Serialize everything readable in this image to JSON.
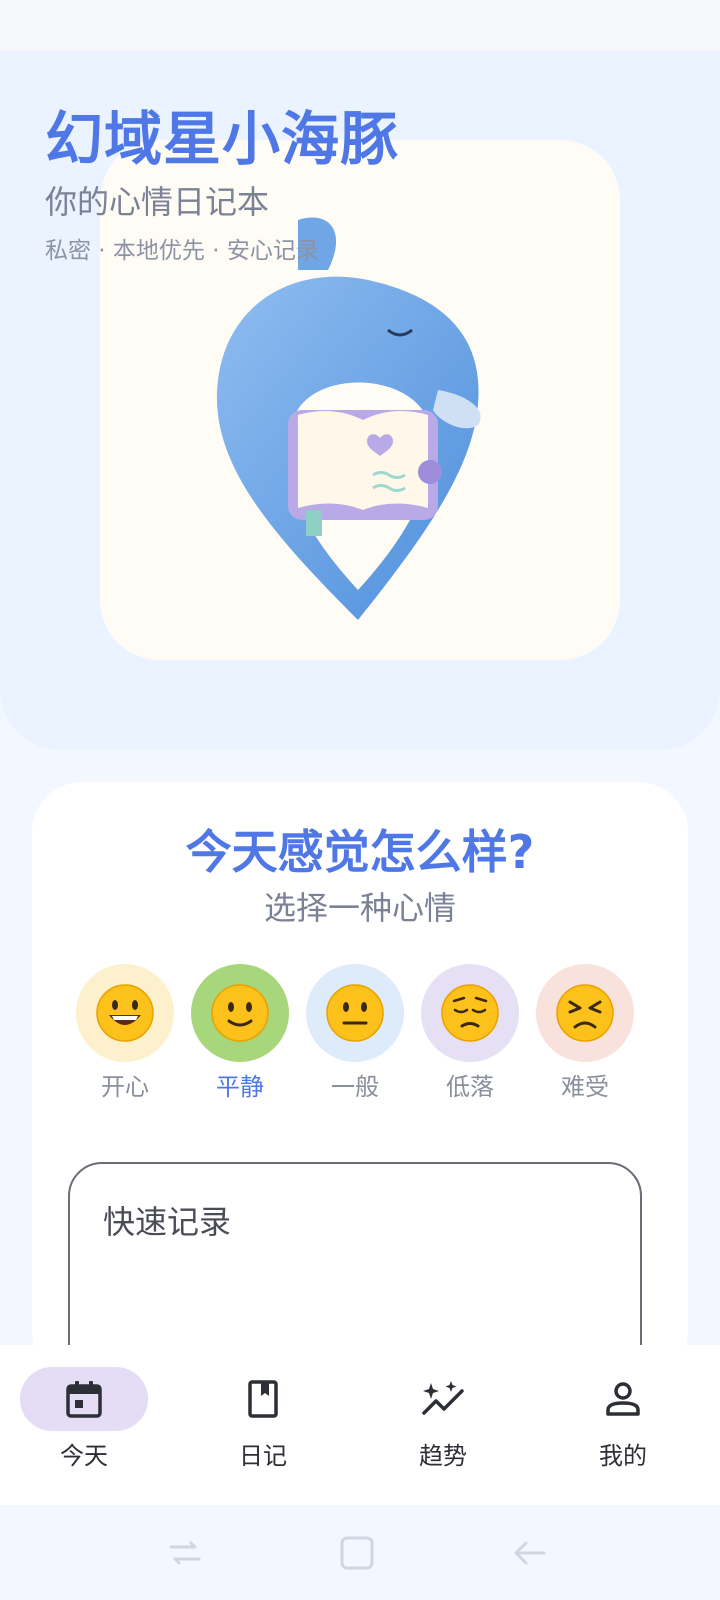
{
  "header": {
    "title": "幻域星小海豚",
    "subtitle": "你的心情日记本",
    "tagline": "私密 · 本地优先 · 安心记录"
  },
  "mood_card": {
    "question": "今天感觉怎么样?",
    "hint": "选择一种心情",
    "moods": [
      {
        "emoji": "😄",
        "label": "开心",
        "color": "#fdf0cd",
        "selected": false
      },
      {
        "emoji": "🙂",
        "label": "平静",
        "color": "#a8d67b",
        "selected": true
      },
      {
        "emoji": "😐",
        "label": "一般",
        "color": "#deebfa",
        "selected": false
      },
      {
        "emoji": "😔",
        "label": "低落",
        "color": "#e6e0f5",
        "selected": false
      },
      {
        "emoji": "😣",
        "label": "难受",
        "color": "#f9e1dc",
        "selected": false
      }
    ],
    "quick_record_label": "快速记录"
  },
  "bottom_nav": {
    "items": [
      {
        "label": "今天",
        "icon": "calendar-icon",
        "active": true
      },
      {
        "label": "日记",
        "icon": "book-icon",
        "active": false
      },
      {
        "label": "趋势",
        "icon": "sparkle-trend-icon",
        "active": false
      },
      {
        "label": "我的",
        "icon": "person-icon",
        "active": false
      }
    ]
  },
  "colors": {
    "accent": "#4f78e6",
    "hero_bg": "#eaf3ff",
    "nav_active": "#e5dcf6"
  }
}
